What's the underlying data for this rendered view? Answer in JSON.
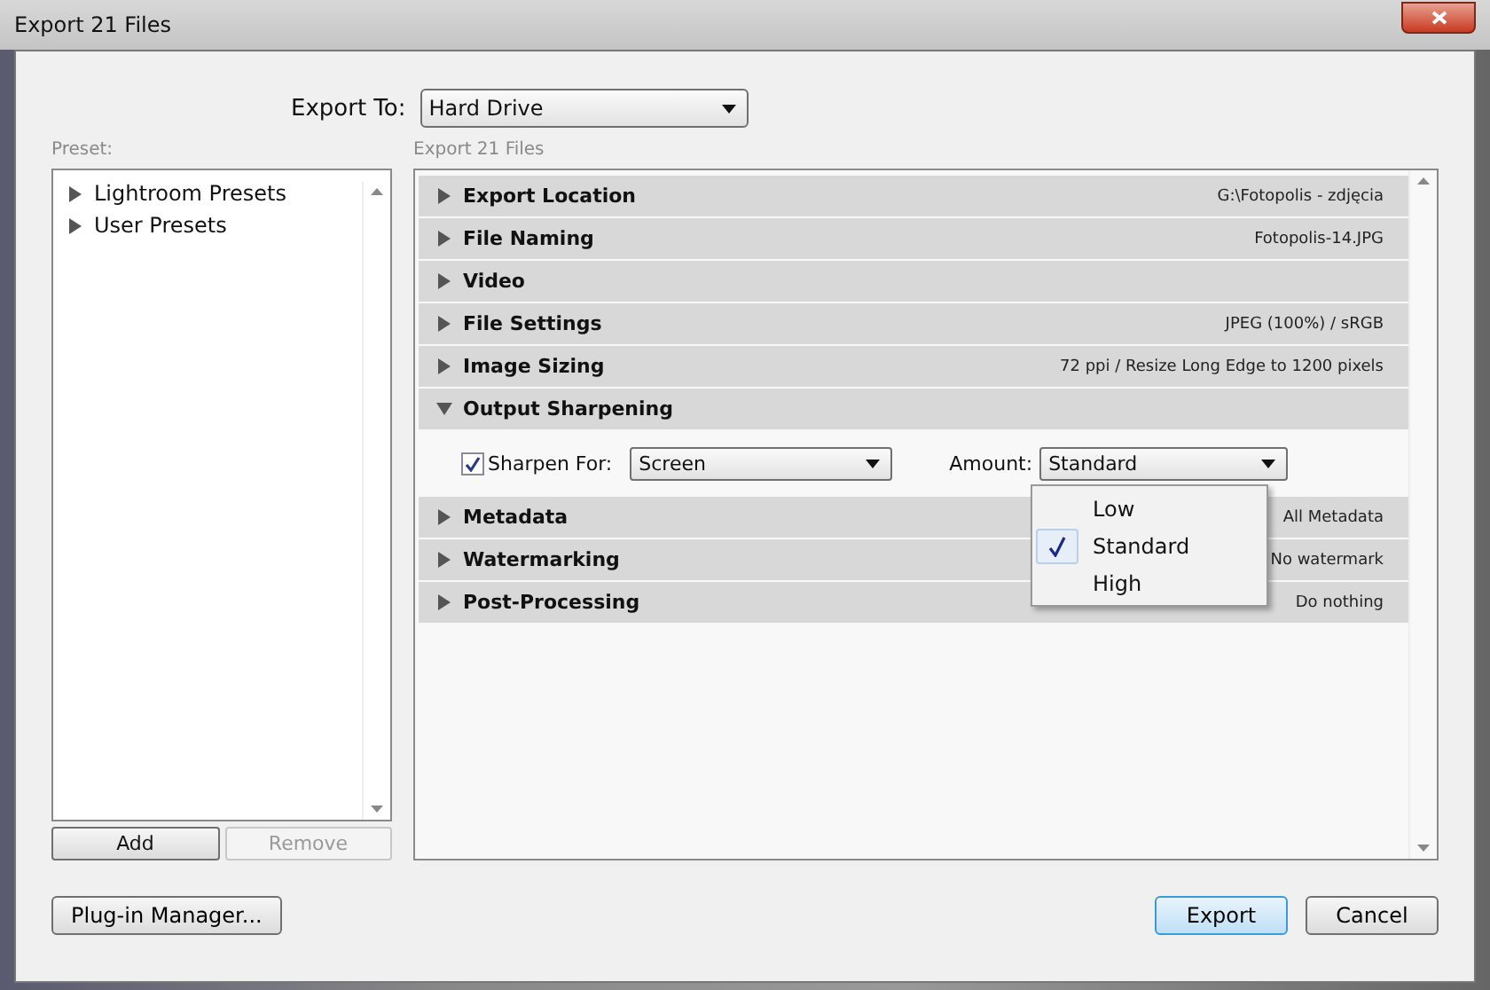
{
  "window": {
    "title": "Export 21 Files"
  },
  "export_to": {
    "label": "Export To:",
    "value": "Hard Drive"
  },
  "preset_label": "Preset:",
  "presets": [
    {
      "label": "Lightroom Presets",
      "expanded": false
    },
    {
      "label": "User Presets",
      "expanded": false
    }
  ],
  "preset_buttons": [
    {
      "label": "Add",
      "disabled": false
    },
    {
      "label": "Remove",
      "disabled": true
    }
  ],
  "panel_title": "Export 21 Files",
  "sections": [
    {
      "title": "Export Location",
      "summary": "G:\\Fotopolis - zdjęcia",
      "expanded": false
    },
    {
      "title": "File Naming",
      "summary": "Fotopolis-14.JPG",
      "expanded": false
    },
    {
      "title": "Video",
      "expanded": false
    },
    {
      "title": "File Settings",
      "summary": "JPEG (100%) / sRGB",
      "expanded": false
    },
    {
      "title": "Image Sizing",
      "summary": "72 ppi / Resize Long Edge to 1200 pixels",
      "expanded": false
    },
    {
      "title": "Output Sharpening",
      "expanded": true
    },
    {
      "title": "Metadata",
      "summary": "All Metadata",
      "expanded": false
    },
    {
      "title": "Watermarking",
      "summary": "No watermark",
      "expanded": false
    },
    {
      "title": "Post-Processing",
      "summary": "Do nothing",
      "expanded": false
    }
  ],
  "sharpening": {
    "checked": true,
    "label": "Sharpen For:",
    "value": "Screen",
    "amount_label": "Amount:",
    "amount_value": "Standard",
    "menu": [
      {
        "label": "Low",
        "selected": false
      },
      {
        "label": "Standard",
        "selected": true
      },
      {
        "label": "High",
        "selected": false
      }
    ]
  },
  "footer": {
    "left": "Plug-in Manager...",
    "buttons": [
      {
        "label": "Export",
        "default": true
      },
      {
        "label": "Cancel",
        "default": false
      }
    ]
  }
}
